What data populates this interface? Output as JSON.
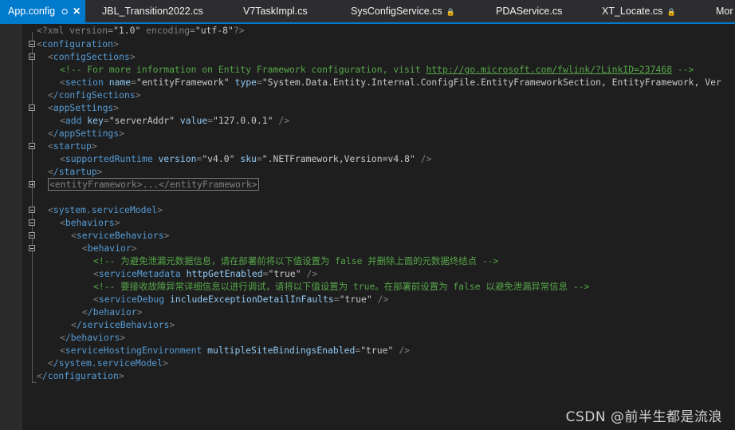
{
  "tabs": [
    {
      "label": "App.config",
      "active": true
    },
    {
      "label": "JBL_Transition2022.cs"
    },
    {
      "label": "V7TaskImpl.cs"
    },
    {
      "label": "SysConfigService.cs",
      "locked": true
    },
    {
      "label": "PDAService.cs"
    },
    {
      "label": "XT_Locate.cs",
      "locked": true
    },
    {
      "label": "Mor"
    }
  ],
  "icons": {
    "pin": "pin-icon",
    "close": "close-icon",
    "lock": "lock-icon"
  },
  "code": {
    "l1": {
      "p1": "<?xml version=",
      "v1": "\"1.0\"",
      "p2": " encoding=",
      "v2": "\"utf-8\"",
      "p3": "?>"
    },
    "l2": {
      "tag": "configuration"
    },
    "l3": {
      "tag": "configSections"
    },
    "l4": {
      "c1": "<!-- For more information on Entity Framework configuration, visit ",
      "url": "http://go.microsoft.com/fwlink/?LinkID=237468",
      "c2": " -->"
    },
    "l5": {
      "tag": "section",
      "a1": "name",
      "v1": "\"entityFramework\"",
      "a2": "type",
      "v2": "\"System.Data.Entity.Internal.ConfigFile.EntityFrameworkSection, EntityFramework, Ver"
    },
    "l6": {
      "tag": "/configSections"
    },
    "l7": {
      "tag": "appSettings"
    },
    "l8": {
      "tag": "add",
      "a1": "key",
      "v1": "\"serverAddr\"",
      "a2": "value",
      "v2": "\"127.0.0.1\"",
      "end": " />"
    },
    "l9": {
      "tag": "/appSettings"
    },
    "l10": {
      "tag": "startup"
    },
    "l11": {
      "tag": "supportedRuntime",
      "a1": "version",
      "v1": "\"v4.0\"",
      "a2": "sku",
      "v2": "\".NETFramework,Version=v4.8\"",
      "end": " />"
    },
    "l12": {
      "tag": "/startup"
    },
    "l13": {
      "text": "<entityFramework>...</entityFramework>"
    },
    "l15": {
      "tag": "system.serviceModel"
    },
    "l16": {
      "tag": "behaviors"
    },
    "l17": {
      "tag": "serviceBehaviors"
    },
    "l18": {
      "tag": "behavior"
    },
    "l19": {
      "c": "<!-- 为避免泄漏元数据信息，请在部署前将以下值设置为 false 并删除上面的元数据终结点 -->"
    },
    "l20": {
      "tag": "serviceMetadata",
      "a1": "httpGetEnabled",
      "v1": "\"true\"",
      "end": " />"
    },
    "l21": {
      "c": "<!-- 要接收故障异常详细信息以进行调试，请将以下值设置为 true。在部署前设置为 false 以避免泄漏异常信息 -->"
    },
    "l22": {
      "tag": "serviceDebug",
      "a1": "includeExceptionDetailInFaults",
      "v1": "\"true\"",
      "end": " />"
    },
    "l23": {
      "tag": "/behavior"
    },
    "l24": {
      "tag": "/serviceBehaviors"
    },
    "l25": {
      "tag": "/behaviors"
    },
    "l26": {
      "tag": "serviceHostingEnvironment",
      "a1": "multipleSiteBindingsEnabled",
      "v1": "\"true\"",
      "end": " />"
    },
    "l27": {
      "tag": "/system.serviceModel"
    },
    "l28": {
      "tag": "/configuration"
    }
  },
  "watermark": "CSDN @前半生都是流浪"
}
